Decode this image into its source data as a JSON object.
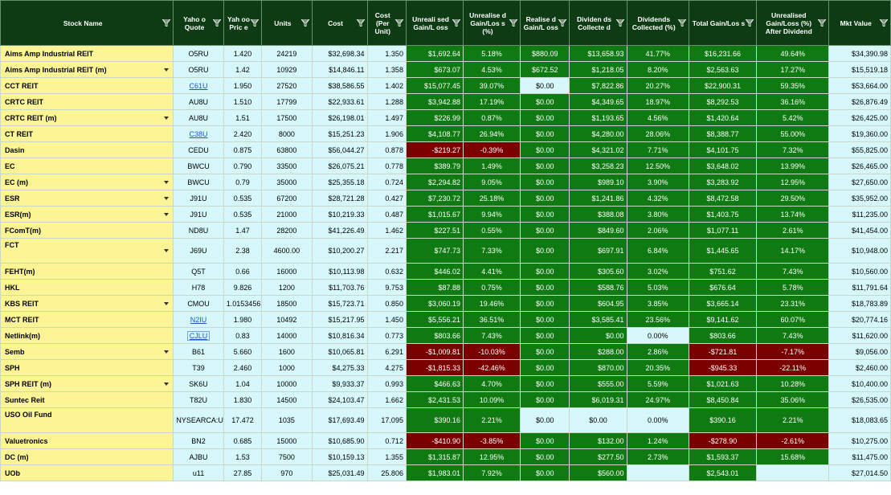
{
  "headers": [
    "Stock Name",
    "Yaho o Quote",
    "Yah oo Pric e",
    "Units",
    "Cost",
    "Cost (Per Unit)",
    "Unreali sed Gain/L oss",
    "Unrealise d Gain/Los s (%)",
    "Realise d Gain/L oss",
    "Dividen ds Collecte d",
    "Dividends Collected (%)",
    "Total Gain/Los s",
    "Unrealised Gain/Loss (%) After Dividend",
    "Mkt Value"
  ],
  "filter_icon": "filter-icon",
  "rows": [
    {
      "name": "Aims Amp Industrial REIT",
      "dropdown": false,
      "quote": "O5RU",
      "quote_link": false,
      "price": "1.420",
      "units": "24219",
      "cost": "$32,698.34",
      "cpu": "1.350",
      "ugl": "$1,692.64",
      "ugl_pct": "5.18%",
      "rgl": "$880.09",
      "div": "$13,658.93",
      "div_pct": "41.77%",
      "total": "$16,231.66",
      "after": "49.64%",
      "mkt": "$34,390.98",
      "ugl_neg": false,
      "total_neg": false,
      "rgl_green": true
    },
    {
      "name": "Aims Amp Industrial REIT (m)",
      "dropdown": true,
      "quote": "O5RU",
      "quote_link": false,
      "price": "1.42",
      "units": "10929",
      "cost": "$14,846.11",
      "cpu": "1.358",
      "ugl": "$673.07",
      "ugl_pct": "4.53%",
      "rgl": "$672.52",
      "div": "$1,218.05",
      "div_pct": "8.20%",
      "total": "$2,563.63",
      "after": "17.27%",
      "mkt": "$15,519.18",
      "ugl_neg": false,
      "total_neg": false,
      "rgl_green": true
    },
    {
      "name": "CCT REIT",
      "dropdown": false,
      "quote": "C61U",
      "quote_link": true,
      "price": "1.950",
      "units": "27520",
      "cost": "$38,586.55",
      "cpu": "1.402",
      "ugl": "$15,077.45",
      "ugl_pct": "39.07%",
      "rgl": "$0.00",
      "div": "$7,822.86",
      "div_pct": "20.27%",
      "total": "$22,900.31",
      "after": "59.35%",
      "mkt": "$53,664.00",
      "ugl_neg": false,
      "total_neg": false,
      "rgl_green": false
    },
    {
      "name": "CRTC REIT",
      "dropdown": false,
      "quote": "AU8U",
      "quote_link": false,
      "price": "1.510",
      "units": "17799",
      "cost": "$22,933.61",
      "cpu": "1.288",
      "ugl": "$3,942.88",
      "ugl_pct": "17.19%",
      "rgl": "$0.00",
      "div": "$4,349.65",
      "div_pct": "18.97%",
      "total": "$8,292.53",
      "after": "36.16%",
      "mkt": "$26,876.49",
      "ugl_neg": false,
      "total_neg": false,
      "rgl_green": true
    },
    {
      "name": "CRTC REIT (m)",
      "dropdown": true,
      "quote": "AU8U",
      "quote_link": false,
      "price": "1.51",
      "units": "17500",
      "cost": "$26,198.01",
      "cpu": "1.497",
      "ugl": "$226.99",
      "ugl_pct": "0.87%",
      "rgl": "$0.00",
      "div": "$1,193.65",
      "div_pct": "4.56%",
      "total": "$1,420.64",
      "after": "5.42%",
      "mkt": "$26,425.00",
      "ugl_neg": false,
      "total_neg": false,
      "rgl_green": true
    },
    {
      "name": "CT REIT",
      "dropdown": false,
      "quote": "C38U",
      "quote_link": true,
      "price": "2.420",
      "units": "8000",
      "cost": "$15,251.23",
      "cpu": "1.906",
      "ugl": "$4,108.77",
      "ugl_pct": "26.94%",
      "rgl": "$0.00",
      "div": "$4,280.00",
      "div_pct": "28.06%",
      "total": "$8,388.77",
      "after": "55.00%",
      "mkt": "$19,360.00",
      "ugl_neg": false,
      "total_neg": false,
      "rgl_green": true
    },
    {
      "name": "Dasin",
      "dropdown": false,
      "quote": "CEDU",
      "quote_link": false,
      "price": "0.875",
      "units": "63800",
      "cost": "$56,044.27",
      "cpu": "0.878",
      "ugl": "-$219.27",
      "ugl_pct": "-0.39%",
      "rgl": "$0.00",
      "div": "$4,321.02",
      "div_pct": "7.71%",
      "total": "$4,101.75",
      "after": "7.32%",
      "mkt": "$55,825.00",
      "ugl_neg": true,
      "total_neg": false,
      "rgl_green": true
    },
    {
      "name": "EC",
      "dropdown": false,
      "quote": "BWCU",
      "quote_link": false,
      "price": "0.790",
      "units": "33500",
      "cost": "$26,075.21",
      "cpu": "0.778",
      "ugl": "$389.79",
      "ugl_pct": "1.49%",
      "rgl": "$0.00",
      "div": "$3,258.23",
      "div_pct": "12.50%",
      "total": "$3,648.02",
      "after": "13.99%",
      "mkt": "$26,465.00",
      "ugl_neg": false,
      "total_neg": false,
      "rgl_green": true
    },
    {
      "name": "EC (m)",
      "dropdown": true,
      "quote": "BWCU",
      "quote_link": false,
      "price": "0.79",
      "units": "35000",
      "cost": "$25,355.18",
      "cpu": "0.724",
      "ugl": "$2,294.82",
      "ugl_pct": "9.05%",
      "rgl": "$0.00",
      "div": "$989.10",
      "div_pct": "3.90%",
      "total": "$3,283.92",
      "after": "12.95%",
      "mkt": "$27,650.00",
      "ugl_neg": false,
      "total_neg": false,
      "rgl_green": true
    },
    {
      "name": "ESR",
      "dropdown": true,
      "quote": "J91U",
      "quote_link": false,
      "price": "0.535",
      "units": "67200",
      "cost": "$28,721.28",
      "cpu": "0.427",
      "ugl": "$7,230.72",
      "ugl_pct": "25.18%",
      "rgl": "$0.00",
      "div": "$1,241.86",
      "div_pct": "4.32%",
      "total": "$8,472.58",
      "after": "29.50%",
      "mkt": "$35,952.00",
      "ugl_neg": false,
      "total_neg": false,
      "rgl_green": true
    },
    {
      "name": "ESR(m)",
      "dropdown": true,
      "quote": "J91U",
      "quote_link": false,
      "price": "0.535",
      "units": "21000",
      "cost": "$10,219.33",
      "cpu": "0.487",
      "ugl": "$1,015.67",
      "ugl_pct": "9.94%",
      "rgl": "$0.00",
      "div": "$388.08",
      "div_pct": "3.80%",
      "total": "$1,403.75",
      "after": "13.74%",
      "mkt": "$11,235.00",
      "ugl_neg": false,
      "total_neg": false,
      "rgl_green": true
    },
    {
      "name": "FComT(m)",
      "dropdown": false,
      "quote": "ND8U",
      "quote_link": false,
      "price": "1.47",
      "units": "28200",
      "cost": "$41,226.49",
      "cpu": "1.462",
      "ugl": "$227.51",
      "ugl_pct": "0.55%",
      "rgl": "$0.00",
      "div": "$849.60",
      "div_pct": "2.06%",
      "total": "$1,077.11",
      "after": "2.61%",
      "mkt": "$41,454.00",
      "ugl_neg": false,
      "total_neg": false,
      "rgl_green": true
    },
    {
      "name": "FCT",
      "dropdown": true,
      "quote": "J69U",
      "quote_link": false,
      "price": "2.38",
      "units": "4600.00",
      "cost": "$10,200.27",
      "cpu": "2.217",
      "ugl": "$747.73",
      "ugl_pct": "7.33%",
      "rgl": "$0.00",
      "div": "$697.91",
      "div_pct": "6.84%",
      "total": "$1,445.65",
      "after": "14.17%",
      "mkt": "$10,948.00",
      "ugl_neg": false,
      "total_neg": false,
      "rgl_green": true,
      "tall": true
    },
    {
      "name": "FEHT(m)",
      "dropdown": false,
      "quote": "Q5T",
      "quote_link": false,
      "price": "0.66",
      "units": "16000",
      "cost": "$10,113.98",
      "cpu": "0.632",
      "ugl": "$446.02",
      "ugl_pct": "4.41%",
      "rgl": "$0.00",
      "div": "$305.60",
      "div_pct": "3.02%",
      "total": "$751.62",
      "after": "7.43%",
      "mkt": "$10,560.00",
      "ugl_neg": false,
      "total_neg": false,
      "rgl_green": true
    },
    {
      "name": "HKL",
      "dropdown": false,
      "quote": "H78",
      "quote_link": false,
      "price": "9.826",
      "units": "1200",
      "cost": "$11,703.76",
      "cpu": "9.753",
      "ugl": "$87.88",
      "ugl_pct": "0.75%",
      "rgl": "$0.00",
      "div": "$588.76",
      "div_pct": "5.03%",
      "total": "$676.64",
      "after": "5.78%",
      "mkt": "$11,791.64",
      "ugl_neg": false,
      "total_neg": false,
      "rgl_green": true
    },
    {
      "name": "KBS REIT",
      "dropdown": true,
      "quote": "CMOU",
      "quote_link": false,
      "price": "1.0153456",
      "units": "18500",
      "cost": "$15,723.71",
      "cpu": "0.850",
      "ugl": "$3,060.19",
      "ugl_pct": "19.46%",
      "rgl": "$0.00",
      "div": "$604.95",
      "div_pct": "3.85%",
      "total": "$3,665.14",
      "after": "23.31%",
      "mkt": "$18,783.89",
      "ugl_neg": false,
      "total_neg": false,
      "rgl_green": true
    },
    {
      "name": "MCT REIT",
      "dropdown": false,
      "quote": "N2IU",
      "quote_link": true,
      "price": "1.980",
      "units": "10492",
      "cost": "$15,217.95",
      "cpu": "1.450",
      "ugl": "$5,556.21",
      "ugl_pct": "36.51%",
      "rgl": "$0.00",
      "div": "$3,585.41",
      "div_pct": "23.56%",
      "total": "$9,141.62",
      "after": "60.07%",
      "mkt": "$20,774.16",
      "ugl_neg": false,
      "total_neg": false,
      "rgl_green": true
    },
    {
      "name": "Netlink(m)",
      "dropdown": false,
      "quote": "CJLU",
      "quote_link": true,
      "quote_selected": true,
      "price": "0.83",
      "units": "14000",
      "cost": "$10,816.34",
      "cpu": "0.773",
      "ugl": "$803.66",
      "ugl_pct": "7.43%",
      "rgl": "$0.00",
      "div": "$0.00",
      "div_pct": "0.00%",
      "total": "$803.66",
      "after": "7.43%",
      "mkt": "$11,620.00",
      "ugl_neg": false,
      "total_neg": false,
      "rgl_green": true,
      "div_pct_plain": true
    },
    {
      "name": "Semb",
      "dropdown": true,
      "quote": "B61",
      "quote_link": false,
      "price": "5.660",
      "units": "1600",
      "cost": "$10,065.81",
      "cpu": "6.291",
      "ugl": "-$1,009.81",
      "ugl_pct": "-10.03%",
      "rgl": "$0.00",
      "div": "$288.00",
      "div_pct": "2.86%",
      "total": "-$721.81",
      "after": "-7.17%",
      "mkt": "$9,056.00",
      "ugl_neg": true,
      "total_neg": true,
      "rgl_green": true
    },
    {
      "name": "SPH",
      "dropdown": false,
      "quote": "T39",
      "quote_link": false,
      "price": "2.460",
      "units": "1000",
      "cost": "$4,275.33",
      "cpu": "4.275",
      "ugl": "-$1,815.33",
      "ugl_pct": "-42.46%",
      "rgl": "$0.00",
      "div": "$870.00",
      "div_pct": "20.35%",
      "total": "-$945.33",
      "after": "-22.11%",
      "mkt": "$2,460.00",
      "ugl_neg": true,
      "total_neg": true,
      "rgl_green": true
    },
    {
      "name": "SPH REIT (m)",
      "dropdown": true,
      "quote": "SK6U",
      "quote_link": false,
      "price": "1.04",
      "units": "10000",
      "cost": "$9,933.37",
      "cpu": "0.993",
      "ugl": "$466.63",
      "ugl_pct": "4.70%",
      "rgl": "$0.00",
      "div": "$555.00",
      "div_pct": "5.59%",
      "total": "$1,021.63",
      "after": "10.28%",
      "mkt": "$10,400.00",
      "ugl_neg": false,
      "total_neg": false,
      "rgl_green": true
    },
    {
      "name": "Suntec Reit",
      "dropdown": false,
      "quote": "T82U",
      "quote_link": false,
      "price": "1.830",
      "units": "14500",
      "cost": "$24,103.47",
      "cpu": "1.662",
      "ugl": "$2,431.53",
      "ugl_pct": "10.09%",
      "rgl": "$0.00",
      "div": "$6,019.31",
      "div_pct": "24.97%",
      "total": "$8,450.84",
      "after": "35.06%",
      "mkt": "$26,535.00",
      "ugl_neg": false,
      "total_neg": false,
      "rgl_green": true
    },
    {
      "name": "USO Oil Fund",
      "dropdown": false,
      "quote": "NYSEARCA:USO",
      "quote_link": false,
      "quote_wrap": true,
      "price": "17.472",
      "units": "1035",
      "cost": "$17,693.49",
      "cpu": "17.095",
      "ugl": "$390.16",
      "ugl_pct": "2.21%",
      "rgl": "$0.00",
      "div": "$0.00",
      "div_pct": "0.00%",
      "total": "$390.16",
      "after": "2.21%",
      "mkt": "$18,083.65",
      "ugl_neg": false,
      "total_neg": false,
      "rgl_green": false,
      "div_plain": true,
      "div_pct_plain": true,
      "tall": true
    },
    {
      "name": "Valuetronics",
      "dropdown": false,
      "quote": "BN2",
      "quote_link": false,
      "price": "0.685",
      "units": "15000",
      "cost": "$10,685.90",
      "cpu": "0.712",
      "ugl": "-$410.90",
      "ugl_pct": "-3.85%",
      "rgl": "$0.00",
      "div": "$132.00",
      "div_pct": "1.24%",
      "total": "-$278.90",
      "after": "-2.61%",
      "mkt": "$10,275.00",
      "ugl_neg": true,
      "total_neg": true,
      "rgl_green": true
    },
    {
      "name": "DC (m)",
      "dropdown": false,
      "quote": "AJBU",
      "quote_link": false,
      "price": "1.53",
      "units": "7500",
      "cost": "$10,159.13",
      "cpu": "1.355",
      "ugl": "$1,315.87",
      "ugl_pct": "12.95%",
      "rgl": "$0.00",
      "div": "$277.50",
      "div_pct": "2.73%",
      "total": "$1,593.37",
      "after": "15.68%",
      "mkt": "$11,475.00",
      "ugl_neg": false,
      "total_neg": false,
      "rgl_green": true
    },
    {
      "name": "UOb",
      "dropdown": false,
      "quote": "u11",
      "quote_link": false,
      "price": "27.85",
      "units": "970",
      "cost": "$25,031.49",
      "cpu": "25.806",
      "ugl": "$1,983.01",
      "ugl_pct": "7.92%",
      "rgl": "$0.00",
      "div": "$560.00",
      "div_pct": "",
      "total": "$2,543.01",
      "after": "",
      "mkt": "$27,014.50",
      "ugl_neg": false,
      "total_neg": false,
      "rgl_green": true,
      "div_pct_plain": true,
      "after_plain": true
    }
  ]
}
